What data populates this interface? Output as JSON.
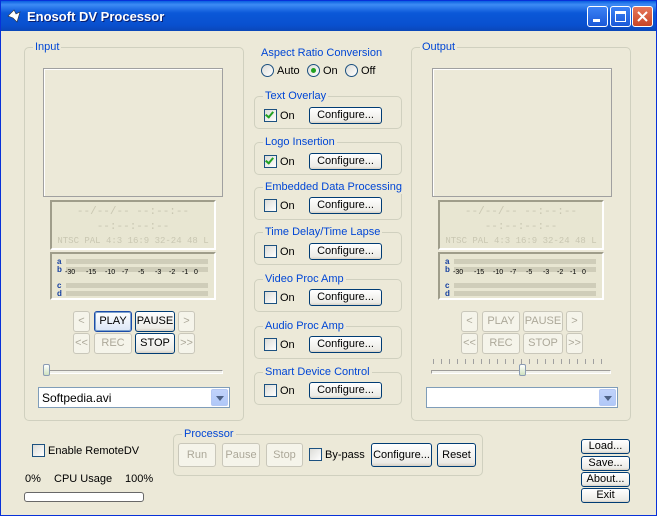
{
  "window": {
    "title": "Enosoft DV Processor"
  },
  "input": {
    "label": "Input",
    "timecode": {
      "line1": "--/--/-- --:--:--",
      "line2": "--:--:--:--",
      "line3": "NTSC PAL 4:3 16:9 32-24 48 L"
    },
    "meter": {
      "channels": [
        "a",
        "b",
        "c",
        "d"
      ],
      "scale": [
        "-30",
        "-15",
        "-10",
        "-7",
        "-5",
        "-3",
        "-2",
        "-1",
        "0"
      ]
    },
    "transport": {
      "prev": "<",
      "play": "PLAY",
      "pause": "PAUSE",
      "next": ">",
      "rewind": "<<",
      "rec": "REC",
      "stop": "STOP",
      "forward": ">>"
    },
    "position": 0.0,
    "file": "Softpedia.avi"
  },
  "center": {
    "aspect": {
      "label": "Aspect Ratio Conversion",
      "options": [
        "Auto",
        "On",
        "Off"
      ],
      "selected": "On"
    },
    "configure_label": "Configure...",
    "on_label": "On",
    "groups": [
      {
        "label": "Text Overlay",
        "checked": true
      },
      {
        "label": "Logo Insertion",
        "checked": true
      },
      {
        "label": "Embedded Data Processing",
        "checked": false
      },
      {
        "label": "Time Delay/Time Lapse",
        "checked": false
      },
      {
        "label": "Video Proc Amp",
        "checked": false
      },
      {
        "label": "Audio Proc Amp",
        "checked": false
      },
      {
        "label": "Smart Device Control",
        "checked": false
      }
    ]
  },
  "output": {
    "label": "Output",
    "timecode": {
      "line1": "--/--/-- --:--:--",
      "line2": "--:--:--:--",
      "line3": "NTSC PAL 4:3 16:9 32-24 48 L"
    },
    "meter": {
      "channels": [
        "a",
        "b",
        "c",
        "d"
      ],
      "scale": [
        "-30",
        "-15",
        "-10",
        "-7",
        "-5",
        "-3",
        "-2",
        "-1",
        "0"
      ]
    },
    "transport": {
      "prev": "<",
      "play": "PLAY",
      "pause": "PAUSE",
      "next": ">",
      "rewind": "<<",
      "rec": "REC",
      "stop": "STOP",
      "forward": ">>"
    },
    "position": 0.5,
    "file": ""
  },
  "bottom": {
    "remote_label": "Enable RemoteDV",
    "cpu": {
      "min": "0%",
      "label": "CPU Usage",
      "max": "100%",
      "value": 0
    },
    "processor": {
      "label": "Processor",
      "run": "Run",
      "pause": "Pause",
      "stop": "Stop",
      "bypass": "By-pass",
      "configure": "Configure...",
      "reset": "Reset"
    },
    "side": {
      "load": "Load...",
      "save": "Save...",
      "about": "About...",
      "exit": "Exit"
    }
  },
  "colors": {
    "title_bar": "#0b58d8",
    "group_label": "#0046d5",
    "check_mark": "#21a121"
  }
}
